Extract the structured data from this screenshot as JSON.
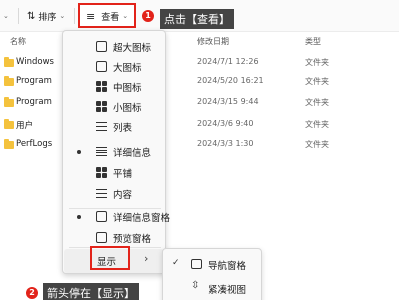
{
  "toolbar": {
    "sort_label": "排序",
    "view_label": "查看",
    "badge1": "1",
    "callout1": "点击【查看】"
  },
  "columns": {
    "name": "名称",
    "modified": "修改日期",
    "type": "类型"
  },
  "files": [
    {
      "name": "Windows",
      "modified": "2024/7/1 12:26",
      "type": "文件夹"
    },
    {
      "name": "Program",
      "modified": "2024/5/20 16:21",
      "type": "文件夹"
    },
    {
      "name": "Program",
      "modified": "2024/3/15 9:44",
      "type": "文件夹"
    },
    {
      "name": "用户",
      "modified": "2024/3/6 9:40",
      "type": "文件夹"
    },
    {
      "name": "PerfLogs",
      "modified": "2024/3/3 1:30",
      "type": "文件夹"
    }
  ],
  "view_menu": {
    "items": [
      {
        "label": "超大图标",
        "icon": "extra-large-icons-icon",
        "selected": false
      },
      {
        "label": "大图标",
        "icon": "large-icons-icon",
        "selected": false
      },
      {
        "label": "中图标",
        "icon": "medium-icons-icon",
        "selected": false
      },
      {
        "label": "小图标",
        "icon": "small-icons-icon",
        "selected": false
      },
      {
        "label": "列表",
        "icon": "list-icon",
        "selected": false
      },
      {
        "label": "详细信息",
        "icon": "details-icon",
        "selected": true
      },
      {
        "label": "平铺",
        "icon": "tiles-icon",
        "selected": false
      },
      {
        "label": "内容",
        "icon": "content-icon",
        "selected": false
      },
      {
        "label": "详细信息窗格",
        "icon": "details-pane-icon",
        "selected": true
      },
      {
        "label": "预览窗格",
        "icon": "preview-pane-icon",
        "selected": false
      }
    ],
    "show_label": "显示",
    "show_arrow": "›"
  },
  "show_submenu": {
    "items": [
      {
        "label": "导航窗格",
        "checked": true
      },
      {
        "label": "紧凑视图",
        "checked": false
      }
    ]
  },
  "annotation2": {
    "badge": "2",
    "text": "箭头停在【显示】"
  },
  "colors": {
    "accent_red": "#e2231a",
    "folder": "#f4c23d",
    "callout_bg": "#444444"
  }
}
